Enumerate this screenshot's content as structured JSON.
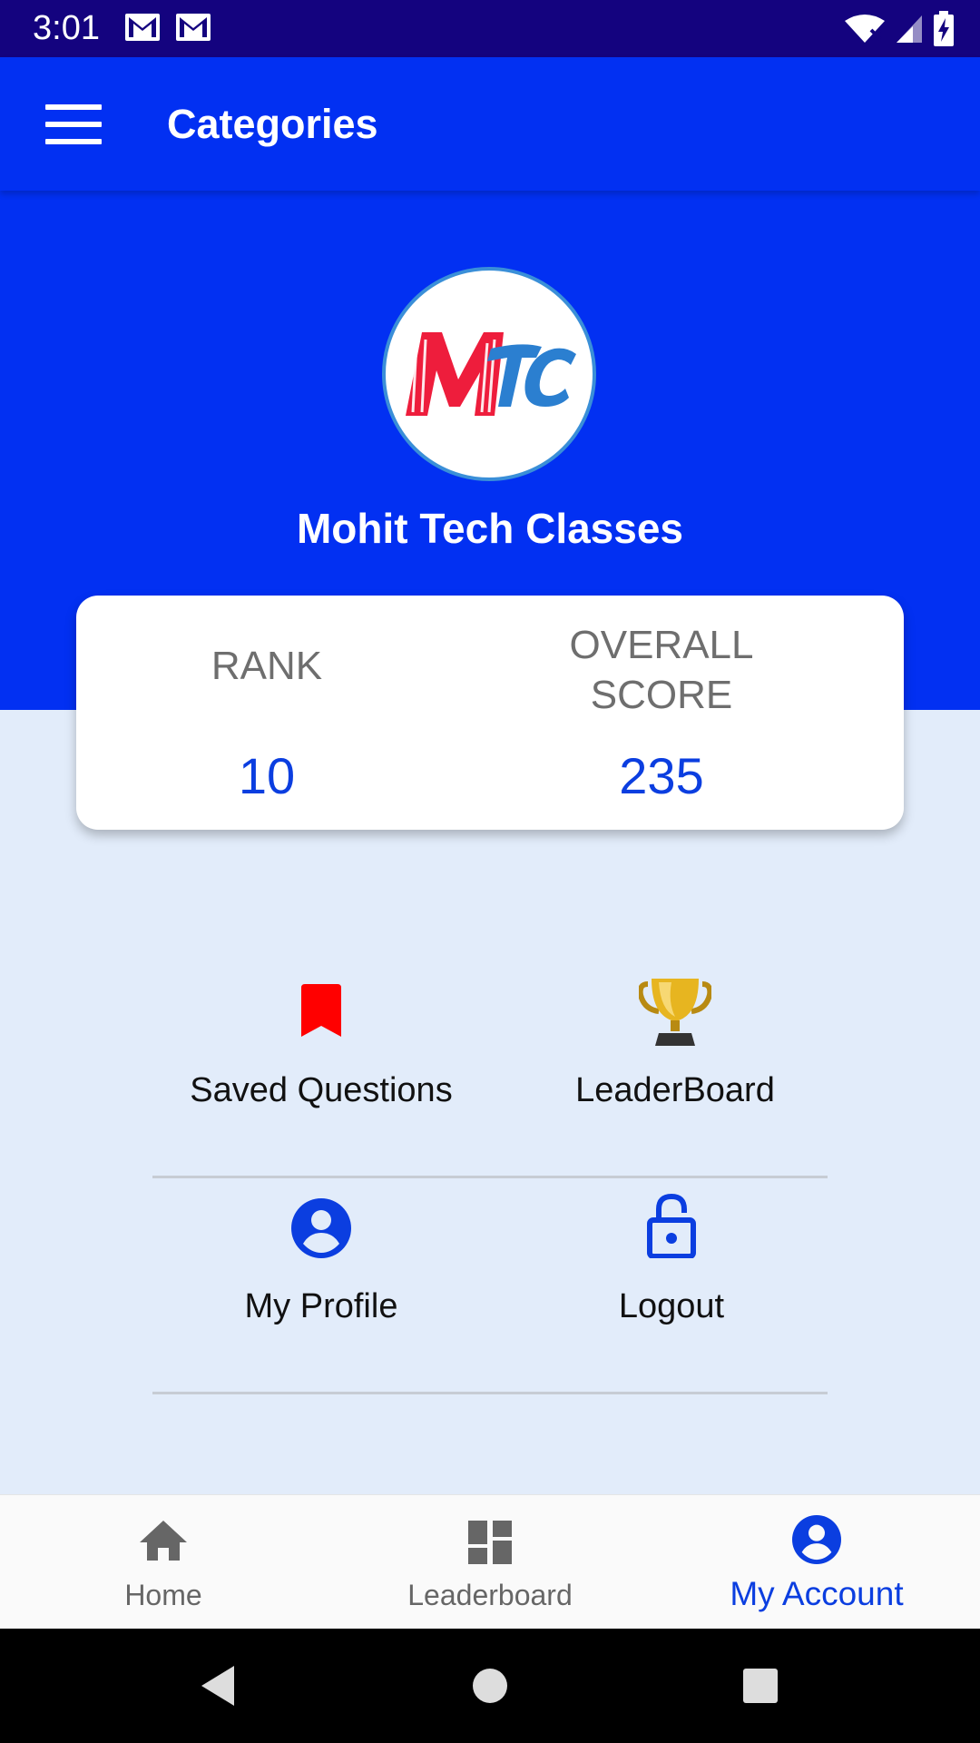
{
  "status_bar": {
    "time": "3:01",
    "notification_icons": [
      "gmail-icon",
      "gmail-icon"
    ],
    "right_icons": [
      "wifi-icon",
      "signal-icon",
      "battery-charging-icon"
    ]
  },
  "app_bar": {
    "title": "Categories",
    "menu_icon": "hamburger-menu-icon"
  },
  "profile": {
    "logo_text": "MTC",
    "name": "Mohit Tech Classes"
  },
  "stats": {
    "rank_label": "RANK",
    "rank_value": "10",
    "score_label_line1": "OVERALL",
    "score_label_line2": "SCORE",
    "score_value": "235"
  },
  "menu": {
    "items": [
      {
        "label": "Saved Questions",
        "icon": "bookmark-icon"
      },
      {
        "label": "LeaderBoard",
        "icon": "trophy-icon"
      },
      {
        "label": "My Profile",
        "icon": "account-circle-icon"
      },
      {
        "label": "Logout",
        "icon": "lock-open-icon"
      }
    ]
  },
  "bottom_nav": {
    "items": [
      {
        "label": "Home",
        "icon": "home-icon"
      },
      {
        "label": "Leaderboard",
        "icon": "dashboard-icon"
      },
      {
        "label": "My Account",
        "icon": "account-circle-icon"
      }
    ],
    "active_index": 2
  },
  "colors": {
    "primary": "#0230f2",
    "status_bar": "#14037f",
    "accent_text": "#0b3ee0",
    "background": "#e2ecfa",
    "bookmark": "#ff0000"
  }
}
